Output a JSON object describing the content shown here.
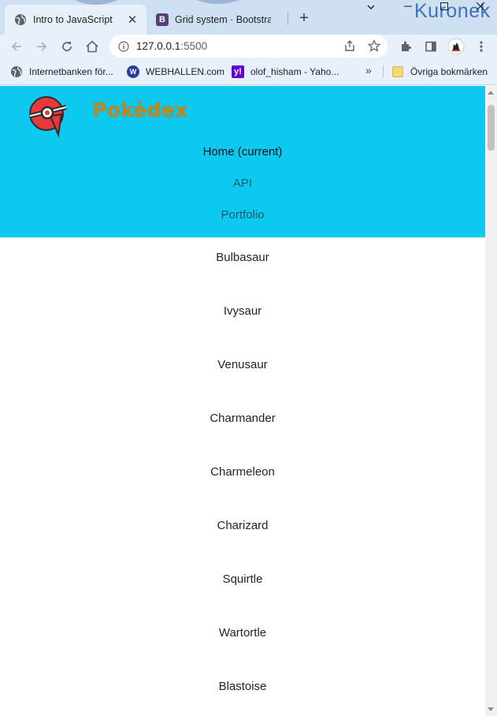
{
  "browser": {
    "tabs": [
      {
        "title": "Intro to JavaScript",
        "icon": "globe-icon",
        "active": true
      },
      {
        "title": "Grid system · Bootstra",
        "icon": "bootstrap-icon",
        "active": false
      }
    ],
    "bootstrap_icon_letter": "B",
    "new_tab": "+",
    "close_glyph": "✕",
    "profile_name": "Kuronek",
    "url": {
      "host": "127.0.0.1",
      "port": ":5500"
    },
    "bookmarks": [
      {
        "label": "Internetbanken för...",
        "icon": "globe-icon"
      },
      {
        "label": "WEBHALLEN.com",
        "icon": "webhallen-icon"
      },
      {
        "label": "olof_hisham - Yaho...",
        "icon": "yahoo-icon"
      }
    ],
    "webhallen_icon_letter": "W",
    "yahoo_icon_letter": "y!",
    "bookmarks_more": "»",
    "other_bookmarks": "Övriga bokmärken"
  },
  "site": {
    "brand": "Pokèdex",
    "nav": [
      {
        "label": "Home (current)",
        "active": true
      },
      {
        "label": "API",
        "active": false
      },
      {
        "label": "Portfolio",
        "active": false
      }
    ],
    "colors": {
      "header_bg": "#0dc9ef",
      "brand": "#b98a26"
    }
  },
  "pokemon": [
    "Bulbasaur",
    "Ivysaur",
    "Venusaur",
    "Charmander",
    "Charmeleon",
    "Charizard",
    "Squirtle",
    "Wartortle",
    "Blastoise"
  ]
}
